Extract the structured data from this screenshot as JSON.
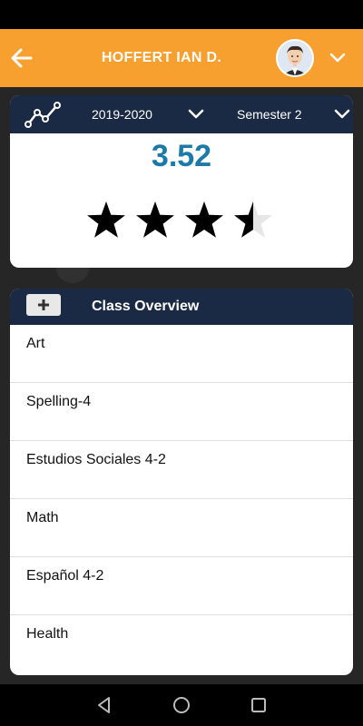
{
  "header": {
    "title": "HOFFERT IAN D."
  },
  "gpa": {
    "year": "2019-2020",
    "semester": "Semester 2",
    "value": "3.52",
    "rating_stars_filled": 3.5,
    "rating_stars_total": 4
  },
  "classes": {
    "title": "Class Overview",
    "add_label": "+",
    "items": [
      "Art",
      "Spelling-4",
      "Estudios Sociales 4-2",
      "Math",
      "Español 4-2",
      "Health"
    ]
  },
  "colors": {
    "header_bg": "#f7a02f",
    "toolbar_bg": "#1a2a44",
    "gpa_text": "#1c7aa8"
  },
  "icons": [
    "back-arrow-icon",
    "avatar",
    "chevron-down-icon",
    "trend-icon",
    "plus-icon",
    "nav-back-icon",
    "nav-home-icon",
    "nav-recents-icon"
  ]
}
